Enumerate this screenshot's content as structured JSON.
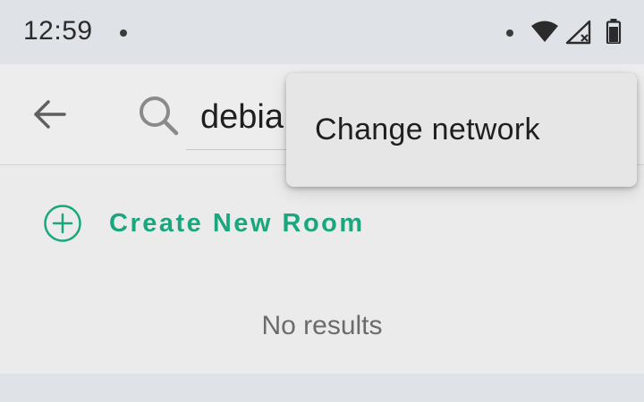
{
  "status_bar": {
    "time": "12:59"
  },
  "search": {
    "value": "debia"
  },
  "create_room": {
    "label": "Create New Room"
  },
  "results": {
    "empty_text": "No results"
  },
  "menu": {
    "items": [
      {
        "label": "Change network"
      }
    ]
  },
  "icons": {
    "back": "arrow-back-icon",
    "search": "search-icon",
    "add": "plus-circle-icon",
    "wifi": "wifi-icon",
    "signal": "cell-signal-no-service-icon",
    "battery": "battery-icon"
  },
  "colors": {
    "accent": "#1aa77d",
    "status_bar_bg": "#dfe2e6",
    "app_bar_bg": "#ededed",
    "menu_bg": "#e6e6e6"
  }
}
